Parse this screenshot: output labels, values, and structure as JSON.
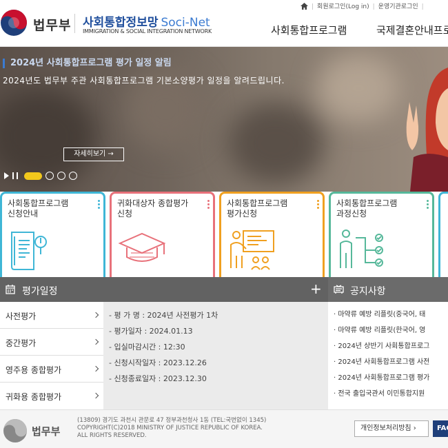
{
  "header": {
    "ministry": "법무부",
    "site_title_ko": "사회통합정보망",
    "site_title_en": "Soci-Net",
    "site_subtitle": "IMMIGRATION & SOCIAL INTEGRATION NETWORK",
    "util_links": [
      "회원로그인(Log in)",
      "운영기관로그인"
    ],
    "nav": [
      "사회통합프로그램",
      "국제결혼안내프로"
    ]
  },
  "banner": {
    "title": "2024년 사회통합프로그램 평가 일정 알림",
    "description": "2024년도 법무부 주관 사회통합프로그램 기본소양평가 일정을 알려드립니다.",
    "more_button": "자세히보기 →",
    "slide_count": 4,
    "active_slide": 1
  },
  "cards": [
    {
      "title": "사회통합프로그램\n신청안내",
      "color": "#3fb6d6"
    },
    {
      "title": "귀화대상자 종합평가\n신청",
      "color": "#e8717a"
    },
    {
      "title": "사회통합프로그램\n평가신청",
      "color": "#f0a020"
    },
    {
      "title": "사회통합프로그램\n과정신청",
      "color": "#56b89a"
    },
    {
      "title": "",
      "color": "#3fb6d6"
    }
  ],
  "schedule": {
    "title": "평가일정",
    "tabs": [
      "사전평가",
      "중간평가",
      "영주용 종합평가",
      "귀화용 종합평가"
    ],
    "details": [
      "- 평 가 명 : 2024년 사전평가 1차",
      "- 평가일자 : 2024.01.13",
      "- 입실마감시간 : 12:30",
      "- 신청시작일자 : 2023.12.26",
      "- 신청종료일자 : 2023.12.30"
    ]
  },
  "notices": {
    "title": "공지사항",
    "items": [
      "· 마약류 예방 리플릿(중국어, 태",
      "· 마약류 예방 리플릿(한국어, 영",
      "· 2024년 상반기 사회통합프로그",
      "· 2024년 사회통합프로그램 사전",
      "· 2024년 사회통합프로그램 평가",
      "· 전국 출입국관서 이민통합지원"
    ]
  },
  "footer": {
    "ministry": "법무부",
    "address": "(13809) 경기도 과천시 관문로 47 정부과천청사 1동 (TEL:국번없이 1345)",
    "copyright1": "COPYRIGHT(C)2018 MINISTRY OF JUSTICE REPUBLIC OF KOREA.",
    "copyright2": "ALL RIGHTS RESERVED.",
    "privacy_button": "개인정보처리방침 ›",
    "fac_button": "FAC"
  },
  "colors": {
    "brand_blue": "#1f4e9c",
    "panel_gray": "#626262",
    "highlight_yellow": "#f2c81c"
  }
}
